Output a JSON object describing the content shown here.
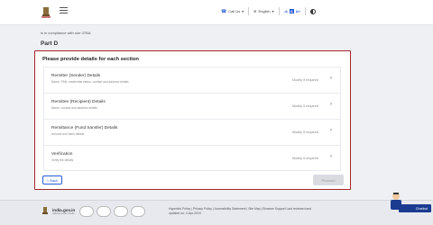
{
  "header": {
    "call_label": "Call Us",
    "language_label": "English",
    "font_controls": [
      "-A",
      "A",
      "A+"
    ]
  },
  "intro": {
    "compliance_text": "is in compliance with rule 37BA.",
    "part_title": "Part D"
  },
  "panel": {
    "title": "Please provide details for each section",
    "sections": [
      {
        "title": "Remitter (Sender) Details",
        "desc": "Name, PAN, residential status, contact and address details",
        "status": "Modify if required"
      },
      {
        "title": "Remittee (Recipient) Details",
        "desc": "Name, contact and address details",
        "status": "Modify if required"
      },
      {
        "title": "Remittance (Fund transfer) Details",
        "desc": "Amount and bank details",
        "status": "Modify if required"
      },
      {
        "title": "Verification",
        "desc": "Verify the details",
        "status": "Modify if required"
      }
    ],
    "back_label": "< Back",
    "proceed_label": "Proceed"
  },
  "footer": {
    "india_gov": "india.gov.in",
    "india_gov_sub": "national portal of india",
    "links": "Hyperlink Policy | Privacy Policy | Accessibility Statement | Site Map | Browser Support  Last reviewed and updated on: 2-Apr-2024"
  },
  "chatbot": {
    "label": "Chatbot"
  }
}
